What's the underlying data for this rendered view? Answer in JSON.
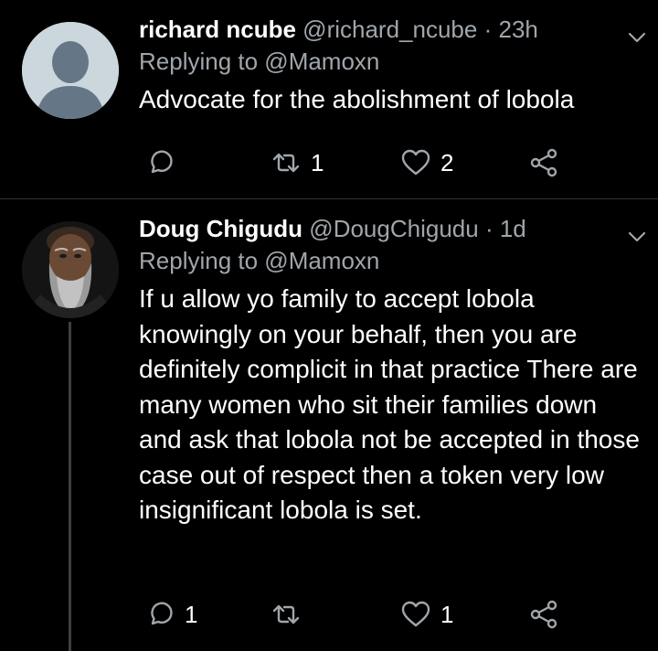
{
  "tweets": [
    {
      "name": "richard ncube",
      "handle": "@richard_ncube",
      "dot": "·",
      "time": "23h",
      "replying": "Replying to @Mamoxn",
      "text": "Advocate for the abolishment of lobola",
      "replies": "",
      "retweets": "1",
      "likes": "2"
    },
    {
      "name": "Doug Chigudu",
      "handle": "@DougChigudu",
      "dot": "·",
      "time": "1d",
      "replying": "Replying to @Mamoxn",
      "text": "If u allow yo family to accept lobola knowingly on your behalf, then you are definitely complicit in that practice There are many women who sit their families down and ask that lobola not be accepted in those case out of respect then a token very low insignificant lobola is set.",
      "replies": "1",
      "retweets": "",
      "likes": "1"
    }
  ],
  "icons": {
    "reply": "reply-icon",
    "retweet": "retweet-icon",
    "like": "heart-icon",
    "share": "share-icon",
    "more": "chevron-down-icon"
  },
  "colors": {
    "background": "#000000",
    "secondary_text": "#a0a6ab",
    "divider": "#2f3336"
  }
}
